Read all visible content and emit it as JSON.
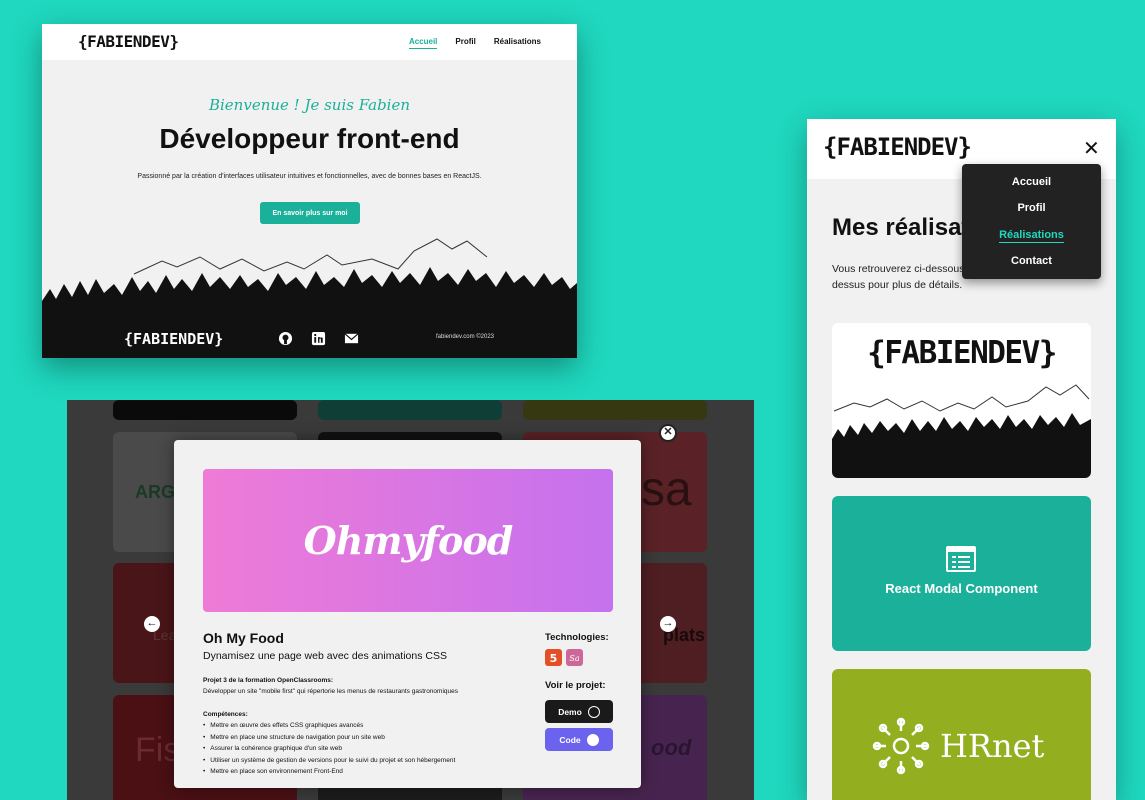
{
  "desktop": {
    "logo": "{FABIENDEV}",
    "nav": [
      "Accueil",
      "Profil",
      "Réalisations"
    ],
    "welcome": "Bienvenue ! Je suis Fabien",
    "title": "Développeur front-end",
    "subtitle": "Passionné par la création d'interfaces utilisateur intuitives et fonctionnelles, avec de bonnes bases en ReactJS.",
    "cta": "En savoir plus sur moi",
    "footer_logo": "{FABIENDEV}",
    "footer_icons": [
      "github-icon",
      "linkedin-icon",
      "mail-icon"
    ],
    "footer_copyright": "fabiendev.com ©2023",
    "accent": "#1bb09a"
  },
  "modal": {
    "banner_text": "Ohmyfood",
    "title": "Oh My Food",
    "subtitle": "Dynamisez une page web avec des animations CSS",
    "project_heading": "Projet 3 de la formation OpenClassrooms:",
    "project_text": "Développer un site \"mobile first\" qui répertorie les menus de restaurants gastronomiques",
    "skills_heading": "Compétences:",
    "skills": [
      "Mettre en œuvre des effets CSS graphiques avancés",
      "Mettre en place une structure de navigation pour un site web",
      "Assurer la cohérence graphique d'un site web",
      "Utiliser un système de gestion de versions pour le suivi du projet et son hébergement",
      "Mettre en place son environnement Front-End"
    ],
    "tech_heading": "Technologies:",
    "tech_icons": [
      "html5-icon",
      "sass-icon"
    ],
    "view_heading": "Voir le projet:",
    "demo_label": "Demo",
    "code_label": "Code",
    "bg_tiles": [
      "ARG",
      "sa",
      "Lea",
      "plats",
      "Fis",
      "ood"
    ]
  },
  "mobile": {
    "logo": "{FABIENDEV}",
    "menu": [
      "Accueil",
      "Profil",
      "Réalisations",
      "Contact"
    ],
    "title": "Mes réalisations",
    "description": "Vous retrouverez ci-dessous mes projets, cliquez dessus pour plus de détails.",
    "cards": [
      {
        "label": "{FABIENDEV}"
      },
      {
        "label": "React Modal Component"
      },
      {
        "label": "HRnet"
      }
    ]
  }
}
